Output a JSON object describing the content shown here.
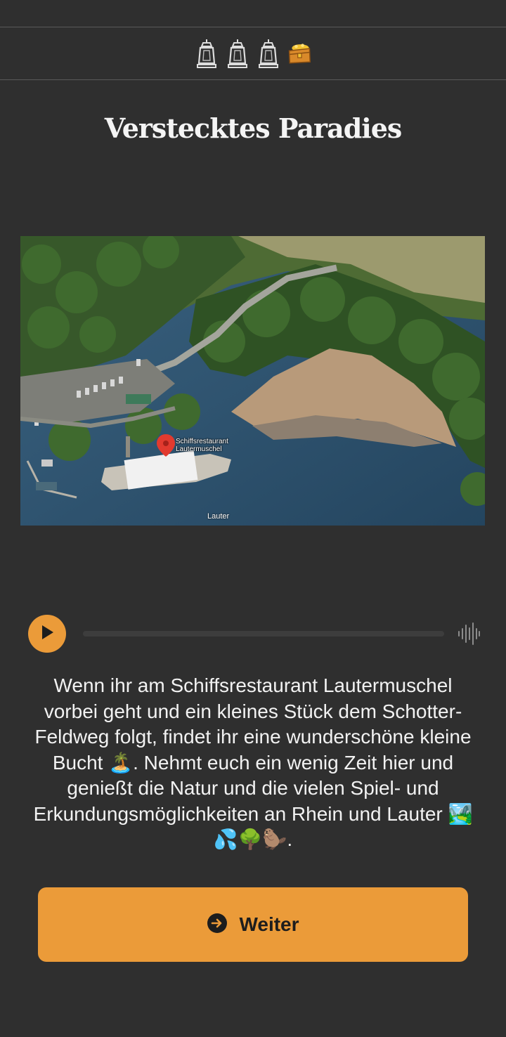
{
  "progress": {
    "items": [
      {
        "icon": "lantern-icon"
      },
      {
        "icon": "lantern-icon"
      },
      {
        "icon": "lantern-icon"
      },
      {
        "icon": "treasure-chest-icon"
      }
    ]
  },
  "page": {
    "title": "Verstecktes Paradies"
  },
  "map": {
    "marker_label": "Schiffsrestaurant Lautermuschel",
    "river_label": "Lauter"
  },
  "audio": {
    "progress": 0,
    "play_icon": "play-icon",
    "waveform_icon": "waveform-icon"
  },
  "description": "Wenn ihr am Schiffsrestaurant Lautermuschel vorbei geht und ein kleines Stück dem Schotter-Feldweg folgt, findet ihr eine wunderschöne kleine Bucht 🏝️. Nehmt euch ein wenig Zeit hier und genießt die Natur und die vielen Spiel- und Erkundungsmöglichkeiten an Rhein und Lauter 🏞️💦🌳🦫.",
  "next_button": {
    "label": "Weiter",
    "icon": "arrow-right-circle-icon"
  },
  "colors": {
    "background": "#2f2f2f",
    "accent": "#eb9b39",
    "text": "#f2f2f2"
  }
}
